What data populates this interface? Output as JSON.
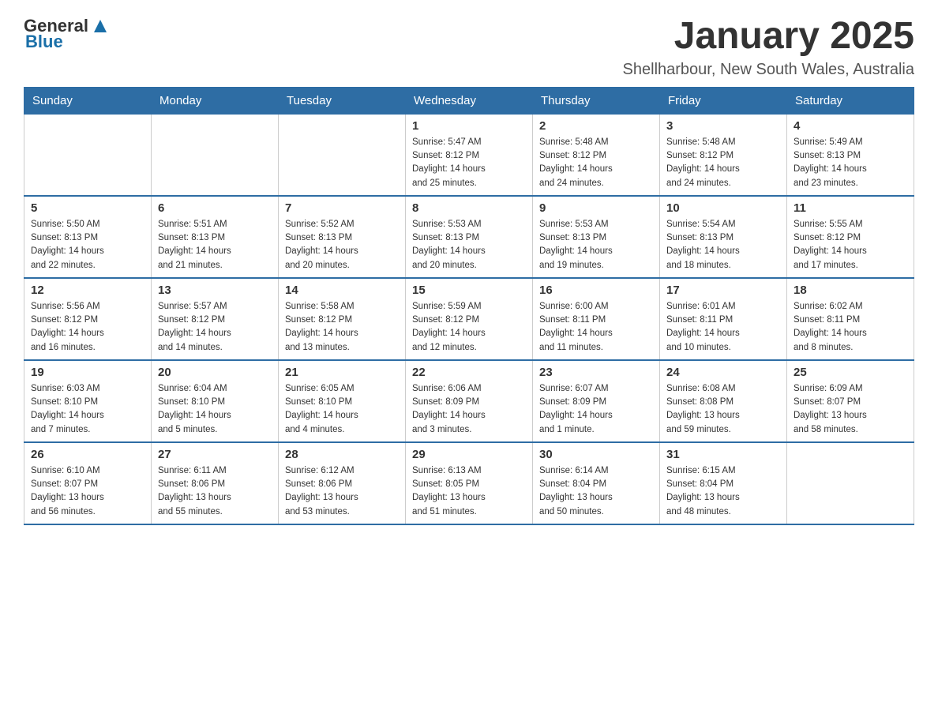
{
  "header": {
    "logo": {
      "general": "General",
      "blue": "Blue"
    },
    "title": "January 2025",
    "location": "Shellharbour, New South Wales, Australia"
  },
  "calendar": {
    "days_of_week": [
      "Sunday",
      "Monday",
      "Tuesday",
      "Wednesday",
      "Thursday",
      "Friday",
      "Saturday"
    ],
    "weeks": [
      [
        {
          "day": "",
          "info": ""
        },
        {
          "day": "",
          "info": ""
        },
        {
          "day": "",
          "info": ""
        },
        {
          "day": "1",
          "info": "Sunrise: 5:47 AM\nSunset: 8:12 PM\nDaylight: 14 hours\nand 25 minutes."
        },
        {
          "day": "2",
          "info": "Sunrise: 5:48 AM\nSunset: 8:12 PM\nDaylight: 14 hours\nand 24 minutes."
        },
        {
          "day": "3",
          "info": "Sunrise: 5:48 AM\nSunset: 8:12 PM\nDaylight: 14 hours\nand 24 minutes."
        },
        {
          "day": "4",
          "info": "Sunrise: 5:49 AM\nSunset: 8:13 PM\nDaylight: 14 hours\nand 23 minutes."
        }
      ],
      [
        {
          "day": "5",
          "info": "Sunrise: 5:50 AM\nSunset: 8:13 PM\nDaylight: 14 hours\nand 22 minutes."
        },
        {
          "day": "6",
          "info": "Sunrise: 5:51 AM\nSunset: 8:13 PM\nDaylight: 14 hours\nand 21 minutes."
        },
        {
          "day": "7",
          "info": "Sunrise: 5:52 AM\nSunset: 8:13 PM\nDaylight: 14 hours\nand 20 minutes."
        },
        {
          "day": "8",
          "info": "Sunrise: 5:53 AM\nSunset: 8:13 PM\nDaylight: 14 hours\nand 20 minutes."
        },
        {
          "day": "9",
          "info": "Sunrise: 5:53 AM\nSunset: 8:13 PM\nDaylight: 14 hours\nand 19 minutes."
        },
        {
          "day": "10",
          "info": "Sunrise: 5:54 AM\nSunset: 8:13 PM\nDaylight: 14 hours\nand 18 minutes."
        },
        {
          "day": "11",
          "info": "Sunrise: 5:55 AM\nSunset: 8:12 PM\nDaylight: 14 hours\nand 17 minutes."
        }
      ],
      [
        {
          "day": "12",
          "info": "Sunrise: 5:56 AM\nSunset: 8:12 PM\nDaylight: 14 hours\nand 16 minutes."
        },
        {
          "day": "13",
          "info": "Sunrise: 5:57 AM\nSunset: 8:12 PM\nDaylight: 14 hours\nand 14 minutes."
        },
        {
          "day": "14",
          "info": "Sunrise: 5:58 AM\nSunset: 8:12 PM\nDaylight: 14 hours\nand 13 minutes."
        },
        {
          "day": "15",
          "info": "Sunrise: 5:59 AM\nSunset: 8:12 PM\nDaylight: 14 hours\nand 12 minutes."
        },
        {
          "day": "16",
          "info": "Sunrise: 6:00 AM\nSunset: 8:11 PM\nDaylight: 14 hours\nand 11 minutes."
        },
        {
          "day": "17",
          "info": "Sunrise: 6:01 AM\nSunset: 8:11 PM\nDaylight: 14 hours\nand 10 minutes."
        },
        {
          "day": "18",
          "info": "Sunrise: 6:02 AM\nSunset: 8:11 PM\nDaylight: 14 hours\nand 8 minutes."
        }
      ],
      [
        {
          "day": "19",
          "info": "Sunrise: 6:03 AM\nSunset: 8:10 PM\nDaylight: 14 hours\nand 7 minutes."
        },
        {
          "day": "20",
          "info": "Sunrise: 6:04 AM\nSunset: 8:10 PM\nDaylight: 14 hours\nand 5 minutes."
        },
        {
          "day": "21",
          "info": "Sunrise: 6:05 AM\nSunset: 8:10 PM\nDaylight: 14 hours\nand 4 minutes."
        },
        {
          "day": "22",
          "info": "Sunrise: 6:06 AM\nSunset: 8:09 PM\nDaylight: 14 hours\nand 3 minutes."
        },
        {
          "day": "23",
          "info": "Sunrise: 6:07 AM\nSunset: 8:09 PM\nDaylight: 14 hours\nand 1 minute."
        },
        {
          "day": "24",
          "info": "Sunrise: 6:08 AM\nSunset: 8:08 PM\nDaylight: 13 hours\nand 59 minutes."
        },
        {
          "day": "25",
          "info": "Sunrise: 6:09 AM\nSunset: 8:07 PM\nDaylight: 13 hours\nand 58 minutes."
        }
      ],
      [
        {
          "day": "26",
          "info": "Sunrise: 6:10 AM\nSunset: 8:07 PM\nDaylight: 13 hours\nand 56 minutes."
        },
        {
          "day": "27",
          "info": "Sunrise: 6:11 AM\nSunset: 8:06 PM\nDaylight: 13 hours\nand 55 minutes."
        },
        {
          "day": "28",
          "info": "Sunrise: 6:12 AM\nSunset: 8:06 PM\nDaylight: 13 hours\nand 53 minutes."
        },
        {
          "day": "29",
          "info": "Sunrise: 6:13 AM\nSunset: 8:05 PM\nDaylight: 13 hours\nand 51 minutes."
        },
        {
          "day": "30",
          "info": "Sunrise: 6:14 AM\nSunset: 8:04 PM\nDaylight: 13 hours\nand 50 minutes."
        },
        {
          "day": "31",
          "info": "Sunrise: 6:15 AM\nSunset: 8:04 PM\nDaylight: 13 hours\nand 48 minutes."
        },
        {
          "day": "",
          "info": ""
        }
      ]
    ]
  }
}
